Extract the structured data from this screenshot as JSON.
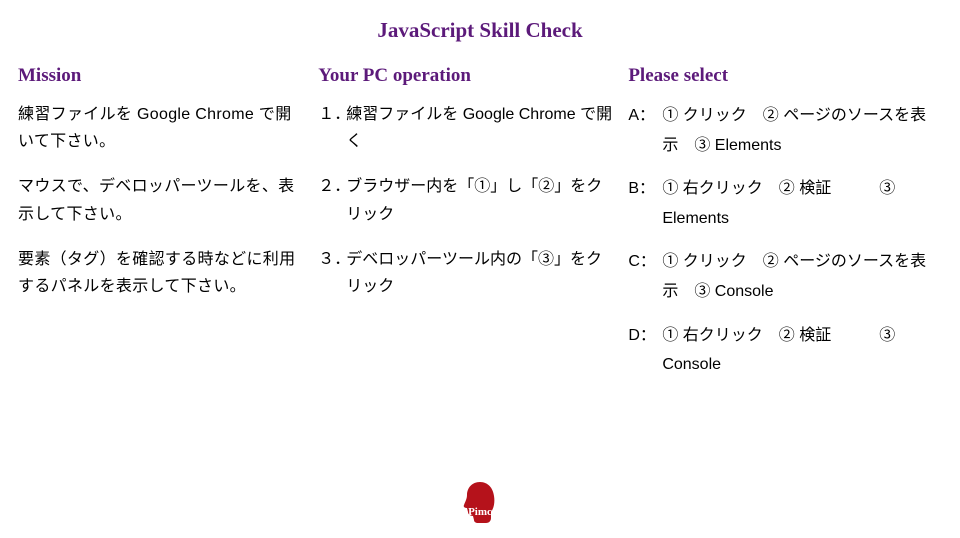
{
  "title": "JavaScript Skill Check",
  "mission": {
    "heading": "Mission",
    "items": [
      "練習ファイルを Google Chrome で開いて下さい。",
      "マウスで、デベロッパーツールを、表示して下さい。",
      "要素（タグ）を確認する時などに利用するパネルを表示して下さい。"
    ]
  },
  "operation": {
    "heading": "Your PC operation",
    "items": [
      {
        "num": "１．",
        "text": "練習ファイルを Google Chrome で開く"
      },
      {
        "num": "２．",
        "text": "ブラウザー内を「①」し「②」をクリック"
      },
      {
        "num": "３．",
        "text": "デベロッパーツール内の「③」をクリック"
      }
    ]
  },
  "select": {
    "heading": "Please select",
    "options": [
      {
        "label": "A：",
        "opts": "① クリック　② ページのソースを表示　③ Elements"
      },
      {
        "label": "B：",
        "opts": "① 右クリック　② 検証　　　③ Elements"
      },
      {
        "label": "C：",
        "opts": "① クリック　② ページのソースを表示　③ Console"
      },
      {
        "label": "D：",
        "opts": "① 右クリック　② 検証　　　③ Console"
      }
    ]
  },
  "logo": {
    "text": "Pimc",
    "color": "#b5121b"
  }
}
